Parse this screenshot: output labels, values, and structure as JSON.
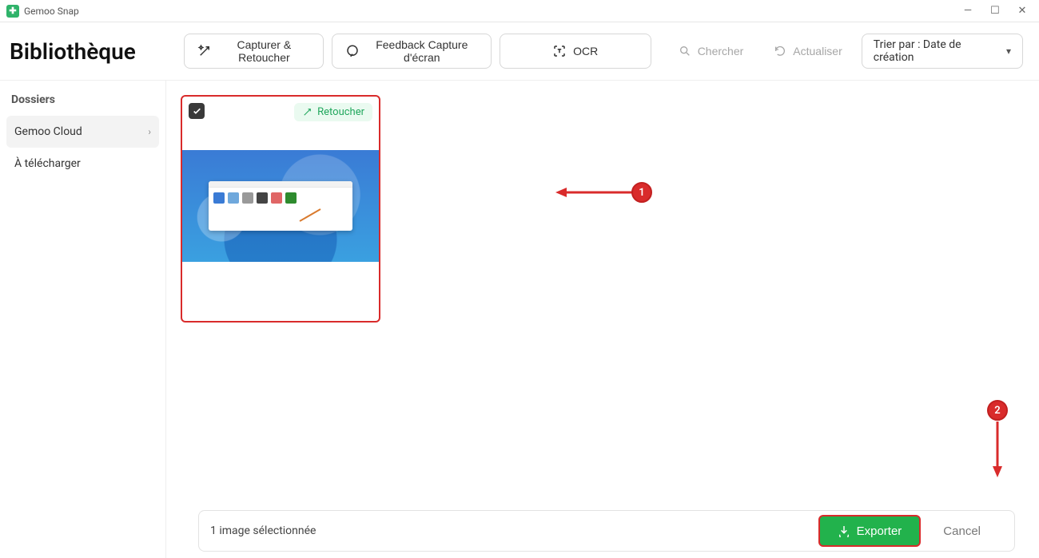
{
  "window": {
    "title": "Gemoo Snap"
  },
  "header": {
    "page_title": "Bibliothèque",
    "capture_label": "Capturer & Retoucher",
    "feedback_label": "Feedback Capture d'écran",
    "ocr_label": "OCR",
    "search_placeholder": "Chercher",
    "refresh_label": "Actualiser",
    "sort_label": "Trier par : Date de création"
  },
  "sidebar": {
    "heading": "Dossiers",
    "items": [
      {
        "label": "Gemoo Cloud",
        "active": true
      },
      {
        "label": "À télécharger",
        "active": false
      }
    ]
  },
  "thumb": {
    "retouch_label": "Retoucher"
  },
  "footer": {
    "status": "1 image sélectionnée",
    "export_label": "Exporter",
    "cancel_label": "Cancel"
  },
  "annotations": {
    "badge1": "1",
    "badge2": "2"
  }
}
